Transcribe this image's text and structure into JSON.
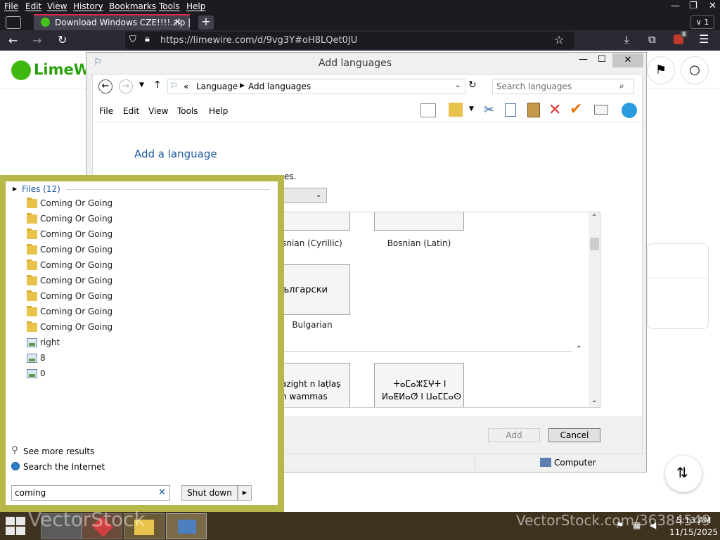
{
  "browser": {
    "menu": [
      "File",
      "Edit",
      "View",
      "History",
      "Bookmarks",
      "Tools",
      "Help"
    ],
    "tab_title": "Download Windows CZE!!!!.zip |",
    "url": "https://limewire.com/d/9vg3Y#oH8LQet0JU",
    "tab_count": "1",
    "extension_badge": "8"
  },
  "page": {
    "logo_text": "LimeWi"
  },
  "dialog": {
    "title": "Add languages",
    "breadcrumb": [
      "«",
      "Language",
      "Add languages"
    ],
    "search_placeholder": "Search languages",
    "menu": [
      "File",
      "Edit",
      "View",
      "Tools",
      "Help"
    ],
    "heading": "Add a language",
    "instruction_partial": "es.",
    "tiles": [
      {
        "caption": "snian (Cyrillic)",
        "text": ""
      },
      {
        "caption": "Bosnian (Latin)",
        "text": ""
      },
      {
        "caption": "Bulgarian",
        "text": "ългарски"
      },
      {
        "caption": "",
        "text": "azight n laṭlaṣ\nn wammas"
      },
      {
        "caption": "",
        "text": "ⵜⴰⵎⴰⵣⵉⵖⵜ ⵏ\nⵍⴰⵟⵍⴰⵚ ⵏ ⵡⴰⵎⵎⴰⵙ"
      }
    ],
    "add_button": "Add",
    "cancel_button": "Cancel",
    "status_computer": "Computer"
  },
  "start_search": {
    "group_header": "Files (12)",
    "results": [
      {
        "type": "folder",
        "label": "Coming Or Going"
      },
      {
        "type": "folder",
        "label": "Coming Or Going"
      },
      {
        "type": "folder",
        "label": "Coming Or Going"
      },
      {
        "type": "folder",
        "label": "Coming Or Going"
      },
      {
        "type": "folder",
        "label": "Coming Or Going"
      },
      {
        "type": "folder",
        "label": "Coming Or Going"
      },
      {
        "type": "folder",
        "label": "Coming Or Going"
      },
      {
        "type": "folder",
        "label": "Coming Or Going"
      },
      {
        "type": "folder",
        "label": "Coming Or Going"
      },
      {
        "type": "image",
        "label": "right"
      },
      {
        "type": "image",
        "label": "8"
      },
      {
        "type": "image",
        "label": "0"
      }
    ],
    "see_more": "See more results",
    "search_internet": "Search the Internet",
    "query": "coming",
    "shutdown": "Shut down"
  },
  "taskbar": {
    "time": "5:13 AM",
    "date": "11/15/2025",
    "watermark": "VectorStock.com/36384549",
    "watermark_left": "VectorStock"
  }
}
